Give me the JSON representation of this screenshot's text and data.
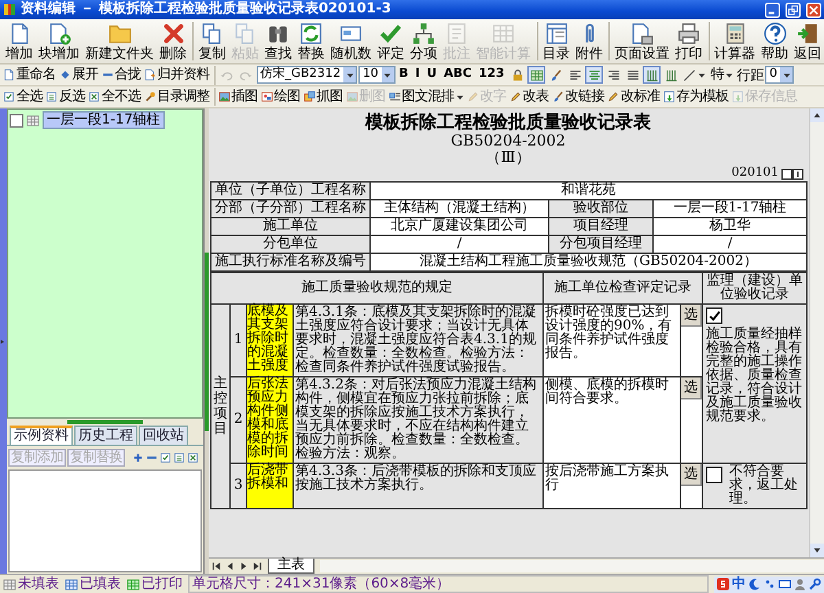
{
  "window": {
    "title": "资料编辑 － 模板拆除工程检验批质量验收记录表020101-3"
  },
  "main_toolbar": [
    [
      {
        "label": "增加",
        "disabled": false
      },
      {
        "label": "块增加",
        "disabled": false
      },
      {
        "label": "新建文件夹",
        "disabled": false
      },
      {
        "label": "删除",
        "disabled": false
      }
    ],
    [
      {
        "label": "复制",
        "disabled": false
      },
      {
        "label": "粘贴",
        "disabled": true
      },
      {
        "label": "查找",
        "disabled": false
      },
      {
        "label": "替换",
        "disabled": false
      },
      {
        "label": "随机数",
        "disabled": false
      },
      {
        "label": "评定",
        "disabled": false
      },
      {
        "label": "分项",
        "disabled": false
      },
      {
        "label": "批注",
        "disabled": true
      },
      {
        "label": "智能计算",
        "disabled": true
      }
    ],
    [
      {
        "label": "目录",
        "disabled": false
      },
      {
        "label": "附件",
        "disabled": false
      }
    ],
    [
      {
        "label": "页面设置",
        "disabled": false
      },
      {
        "label": "打印",
        "disabled": false
      }
    ],
    [
      {
        "label": "计算器",
        "disabled": false
      },
      {
        "label": "帮助",
        "disabled": false
      },
      {
        "label": "返回",
        "disabled": false
      }
    ]
  ],
  "tree_tools": [
    {
      "label": "重命名"
    },
    {
      "label": "展开"
    },
    {
      "label": "合拢"
    },
    {
      "label": "归并资料"
    }
  ],
  "format_tools": [
    {
      "kind": "icon",
      "disabled": true,
      "pressed": false
    },
    {
      "kind": "icon",
      "disabled": true,
      "pressed": false
    },
    {
      "kind": "select",
      "value": "仿宋_GB2312"
    },
    {
      "kind": "select",
      "value": "10"
    },
    {
      "kind": "text",
      "label": "B",
      "pressed": false
    },
    {
      "kind": "text",
      "label": "I",
      "pressed": false
    },
    {
      "kind": "text",
      "label": "U",
      "pressed": false
    },
    {
      "kind": "text",
      "label": "ABC",
      "pressed": false
    },
    {
      "kind": "text",
      "label": "123",
      "pressed": false
    },
    {
      "kind": "icon",
      "disabled": false,
      "pressed": false
    },
    {
      "kind": "icon",
      "disabled": false,
      "pressed": true
    },
    {
      "kind": "icon",
      "disabled": false,
      "pressed": false
    },
    {
      "kind": "icon",
      "disabled": false,
      "pressed": false
    },
    {
      "kind": "icon",
      "disabled": false,
      "pressed": true
    },
    {
      "kind": "icon",
      "disabled": false,
      "pressed": false
    },
    {
      "kind": "icon",
      "disabled": false,
      "pressed": false
    },
    {
      "kind": "icon",
      "disabled": false,
      "pressed": true
    },
    {
      "kind": "icon",
      "disabled": false,
      "pressed": false
    },
    {
      "kind": "dropdown"
    },
    {
      "kind": "dropdown",
      "label": "特"
    },
    {
      "kind": "label",
      "label": "行距"
    },
    {
      "kind": "select",
      "value": "0"
    }
  ],
  "list_tools": [
    {
      "label": "全选"
    },
    {
      "label": "反选"
    },
    {
      "label": "全不选"
    },
    {
      "label": "目录调整"
    }
  ],
  "edit_tools": [
    {
      "label": "插图",
      "disabled": false,
      "menu": false
    },
    {
      "label": "绘图",
      "disabled": false,
      "menu": false
    },
    {
      "label": "抓图",
      "disabled": false,
      "menu": false
    },
    {
      "label": "删图",
      "disabled": true,
      "menu": false
    },
    {
      "label": "图文混排",
      "disabled": false,
      "menu": true
    },
    {
      "label": "改字",
      "disabled": true,
      "menu": false
    },
    {
      "label": "改表",
      "disabled": false,
      "menu": false
    },
    {
      "label": "改链接",
      "disabled": false,
      "menu": false
    },
    {
      "label": "改标准",
      "disabled": false,
      "menu": false
    },
    {
      "label": "存为模板",
      "disabled": false,
      "menu": false
    },
    {
      "label": "保存信息",
      "disabled": true,
      "menu": false
    }
  ],
  "tree": [
    {
      "label": "一层一段1-17轴柱",
      "checked": false,
      "selected": true
    }
  ],
  "panel_tabs": [
    {
      "label": "示例资料",
      "selected": true
    },
    {
      "label": "历史工程",
      "selected": false
    },
    {
      "label": "回收站",
      "selected": false
    }
  ],
  "panel_buttons": [
    {
      "label": "复制添加",
      "disabled": true
    },
    {
      "label": "复制替换",
      "disabled": true
    }
  ],
  "document": {
    "title": "模板拆除工程检验批质量验收记录表",
    "standard": "GB50204-2002",
    "volume": "（Ⅲ）",
    "code": "020101",
    "info": [
      {
        "label": "单位（子单位）工程名称",
        "value": "和谐花苑"
      },
      {
        "label": "分部（子分部）工程名称",
        "value": "主体结构（混凝土结构）",
        "label2": "验收部位",
        "value2": "一层一段1-17轴柱"
      },
      {
        "label": "施工单位",
        "value": "北京广厦建设集团公司",
        "label2": "项目经理",
        "value2": "杨卫华"
      },
      {
        "label": "分包单位",
        "value": "/",
        "label2": "分包项目经理",
        "value2": "/"
      },
      {
        "label": "施工执行标准名称及编号",
        "value": "混凝土结构工程施工质量验收规范（GB50204-2002）"
      }
    ],
    "headers": [
      "施工质量验收规范的规定",
      "施工单位检查评定记录",
      "监理（建设）单位验收记录"
    ],
    "section": "主控项目",
    "rows": [
      {
        "number": "1",
        "item": "底模及其支架拆除时的混凝土强度",
        "clause": "第4.3.1条：底模及其支架拆除时的混凝土强度应符合设计要求；当设计无具体要求时，混凝土强度应符合表4.3.1的规定。检查数量：全数检查。检验方法：检查同条件养护试件强度试验报告。",
        "record": "拆模时砼强度已达到设计强度的90%，有同条件养护试件强度报告。",
        "pick": "选"
      },
      {
        "number": "2",
        "item": "后张法预应力构件侧模和底模的拆除时间",
        "clause": "第4.3.2条：对后张法预应力混凝土结构构件，侧模宜在预应力张拉前拆除；底模支架的拆除应按施工技术方案执行，当无具体要求时，不应在结构构件建立预应力前拆除。检查数量：全数检查。检验方法：观察。",
        "record": "侧模、底模的拆模时间符合要求。",
        "pick": "选"
      },
      {
        "number": "3",
        "item": "后浇带拆模和",
        "clause": "第4.3.3条：后浇带模板的拆除和支顶应按施工技术方案执行。",
        "record": "按后浇带施工方案执行",
        "pick": "选"
      }
    ],
    "verdicts": [
      {
        "checked": true,
        "text": "施工质量经抽样检验合格，具有完整的施工操作依据、质量检查记录，符合设计及施工质量验收规范要求。"
      },
      {
        "checked": false,
        "text": "不符合要求，返工处理。"
      }
    ]
  },
  "sheet_tabs": [
    {
      "label": "主表",
      "selected": true
    }
  ],
  "status_bar": {
    "legend": [
      "未填表",
      "已填表",
      "已打印"
    ],
    "cell_size": "单元格尺寸：241×31像素（60×8毫米）",
    "ime": "中"
  }
}
